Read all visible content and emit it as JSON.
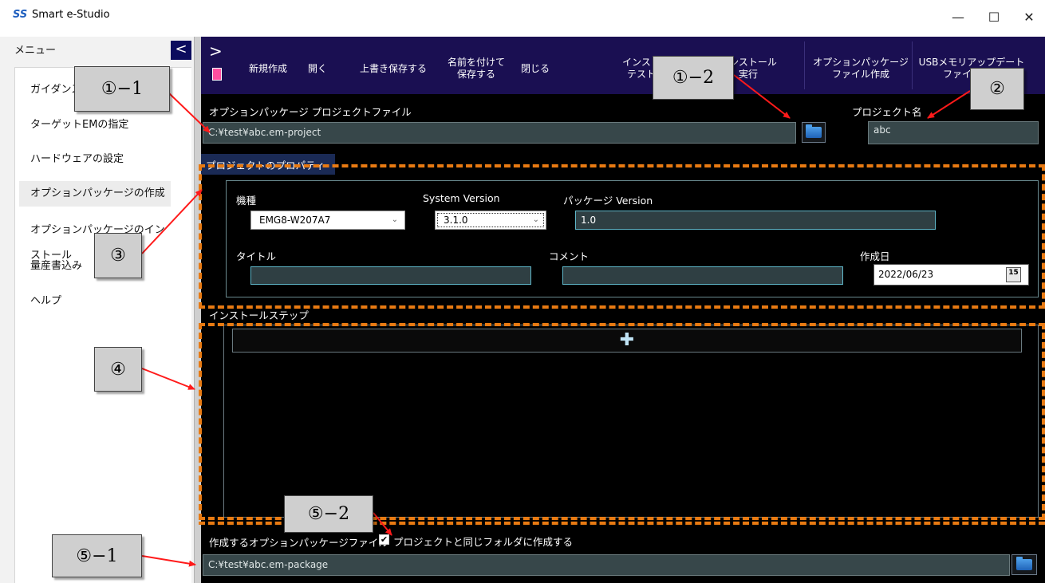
{
  "window": {
    "logo": "SS",
    "title": "Smart e-Studio",
    "minimize": "—",
    "maximize": "☐",
    "close": "✕"
  },
  "sidebar": {
    "menu_label": "メニュー",
    "toggle": "<",
    "items": [
      {
        "label": "ガイダンス"
      },
      {
        "label": "ターゲットEMの指定"
      },
      {
        "label": "ハードウェアの設定"
      },
      {
        "label": "オプションパッケージの作成",
        "active": true
      },
      {
        "label": "オプションパッケージのインストール"
      },
      {
        "label": "量産書込み"
      },
      {
        "label": "ヘルプ"
      }
    ]
  },
  "toolbar": {
    "expand": ">",
    "buttons": [
      {
        "label": "新規作成"
      },
      {
        "label": "開く"
      },
      {
        "label": "上書き保存する"
      },
      {
        "label": "名前を付けて\n保存する"
      },
      {
        "label": "閉じる"
      },
      {
        "label": "インストール\nテスト実行"
      },
      {
        "label": "インストール\n実行"
      },
      {
        "label": "オプションパッケージ\nファイル作成"
      },
      {
        "label": "USBメモリアップデート\nファイル作成"
      }
    ]
  },
  "project": {
    "file_label": "オプションパッケージ プロジェクトファイル",
    "file_path": "C:¥test¥abc.em-project",
    "name_label": "プロジェクト名",
    "name_value": "abc"
  },
  "properties": {
    "header": "プロジェクトのプロパティ",
    "model_label": "機種",
    "model_value": "EMG8-W207A7",
    "system_version_label": "System Version",
    "system_version_value": "3.1.0",
    "package_version_label": "パッケージ Version",
    "package_version_value": "1.0",
    "title_label": "タイトル",
    "title_value": "",
    "comment_label": "コメント",
    "comment_value": "",
    "date_label": "作成日",
    "date_value": "2022/06/23",
    "calendar_text": "15"
  },
  "install": {
    "title": "インストールステップ",
    "add": "✚"
  },
  "output": {
    "label": "作成するオプションパッケージファイル",
    "checkbox_checked": true,
    "checkbox_mark": "✔",
    "checkbox_label": "プロジェクトと同じフォルダに作成する",
    "path": "C:¥test¥abc.em-package"
  },
  "annotations": {
    "c1_1": "①−1",
    "c1_2": "①−2",
    "c2": "②",
    "c3": "③",
    "c4": "④",
    "c5_1": "⑤−1",
    "c5_2": "⑤−2",
    "dash_color": "#e87a12",
    "arrow_color": "#ff1a1a"
  }
}
